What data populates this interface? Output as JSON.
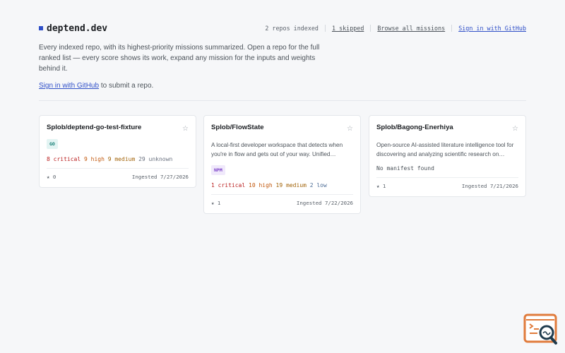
{
  "header": {
    "brand": "deptend.dev",
    "repos_indexed": "2 repos indexed",
    "skipped": "1 skipped",
    "browse": "Browse all missions",
    "sign_in": "Sign in with GitHub"
  },
  "intro": {
    "text": "Every indexed repo, with its highest-priority missions summarized. Open a repo for the full ranked list — every score shows its work, expand any mission for the inputs and weights behind it.",
    "signin_link": "Sign in with GitHub",
    "signin_suffix": " to submit a repo."
  },
  "cards": [
    {
      "title": "Splob/deptend-go-test-fixture",
      "badge": "GO",
      "counts": {
        "critical": "8 critical",
        "high": "9 high",
        "medium": "9 medium",
        "unknown": "29 unknown"
      },
      "stars": "★ 0",
      "ingested": "Ingested 7/27/2026"
    },
    {
      "title": "Splob/FlowState",
      "description": "A local-first developer workspace that detects when you're in flow and gets out of your way. Unified…",
      "badge": "NPM",
      "counts": {
        "critical": "1 critical",
        "high": "10 high",
        "medium": "19 medium",
        "low": "2 low"
      },
      "stars": "★ 1",
      "ingested": "Ingested 7/22/2026"
    },
    {
      "title": "Splob/Bagong-Enerhiya",
      "description": "Open-source AI-assisted literature intelligence tool for discovering and analyzing scientific research on…",
      "no_manifest": "No manifest found",
      "stars": "★ 1",
      "ingested": "Ingested 7/21/2026"
    }
  ],
  "colors": {
    "accent": "#2f4fc8",
    "critical": "#b91c1c",
    "high": "#c2570c",
    "medium": "#a16207",
    "low": "#4b6b95"
  },
  "icons": {
    "star": "star-icon",
    "corner": "search-code-icon"
  }
}
